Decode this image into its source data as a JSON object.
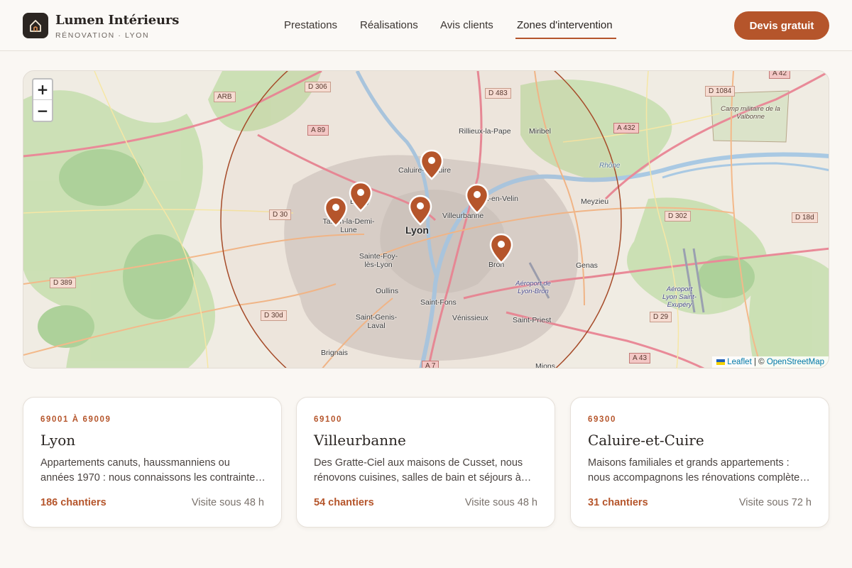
{
  "header": {
    "brand_name": "Lumen Intérieurs",
    "brand_sub": "RÉNOVATION · LYON",
    "logo_icon": "house-icon",
    "nav": [
      {
        "label": "Prestations"
      },
      {
        "label": "Réalisations"
      },
      {
        "label": "Avis clients"
      },
      {
        "label": "Zones d'intervention",
        "active": true
      }
    ],
    "cta_label": "Devis gratuit"
  },
  "map": {
    "zoom_in": "+",
    "zoom_out": "−",
    "attribution": {
      "leaflet": "Leaflet",
      "separator": " | © ",
      "osm": "OpenStreetMap"
    },
    "cities": [
      "Lyon",
      "Caluire-et-Cuire",
      "Villeurbanne",
      "Vaulx-en-Velin",
      "Écully",
      "Tassin-la-Demi-Lune",
      "Bron",
      "Sainte-Foy-lès-Lyon",
      "Oullins",
      "Saint-Fons",
      "Vénissieux",
      "Saint-Genis-Laval",
      "Saint-Priest",
      "Brignais",
      "Rillieux-la-Pape",
      "Miribel",
      "Meyzieu",
      "Genas",
      "Mions"
    ],
    "places": [
      "Camp militaire de la Valbonne",
      "Aéroport de Lyon-Bron",
      "Aéroport Lyon Saint-Exupéry",
      "Rhône"
    ],
    "roads": [
      "D 306",
      "ARB",
      "A 89",
      "D 30",
      "D 389",
      "D 30d",
      "D 483",
      "A 42",
      "D 1084",
      "A 432",
      "D 302",
      "D 18d",
      "D 29",
      "A 43",
      "A 7"
    ],
    "accent": "#b5552b"
  },
  "cards": [
    {
      "code": "69001 À 69009",
      "title": "Lyon",
      "desc": "Appartements canuts, haussmanniens ou années 1970 : nous connaissons les contraintes techniques de chaque époque.",
      "count": "186 chantiers",
      "visit": "Visite sous 48 h"
    },
    {
      "code": "69100",
      "title": "Villeurbanne",
      "desc": "Des Gratte-Ciel aux maisons de Cusset, nous rénovons cuisines, salles de bain et séjours à votre rythme.",
      "count": "54 chantiers",
      "visit": "Visite sous 48 h"
    },
    {
      "code": "69300",
      "title": "Caluire-et-Cuire",
      "desc": "Maisons familiales et grands appartements : nous accompagnons les rénovations complètes de A à Z.",
      "count": "31 chantiers",
      "visit": "Visite sous 72 h"
    }
  ]
}
